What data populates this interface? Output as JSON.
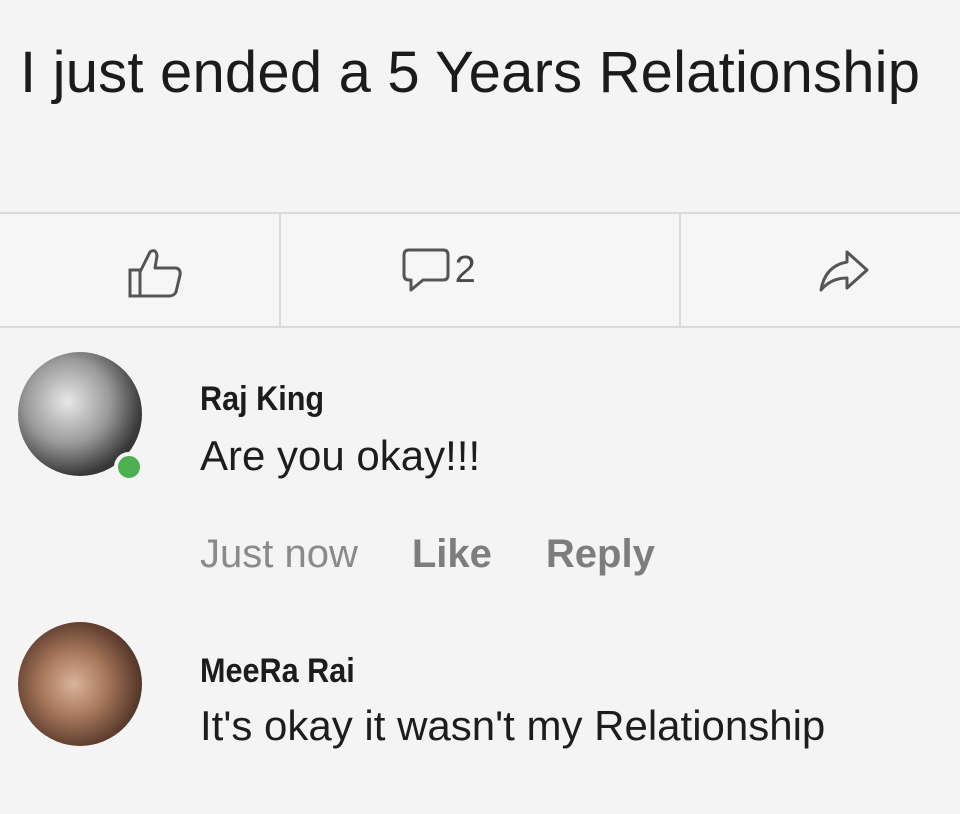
{
  "post": {
    "text": "I just ended a 5 Years Relationship"
  },
  "actions": {
    "comment_count": "2"
  },
  "comments": [
    {
      "author": "Raj King",
      "text": "Are you okay!!!",
      "time": "Just now",
      "like_label": "Like",
      "reply_label": "Reply"
    },
    {
      "author": "MeeRa Rai",
      "text": "It's okay it wasn't my Relationship"
    }
  ],
  "icons": {
    "like": "thumbs-up-icon",
    "comment": "comment-bubble-icon",
    "share": "share-arrow-icon"
  },
  "colors": {
    "online": "#4caf50"
  }
}
